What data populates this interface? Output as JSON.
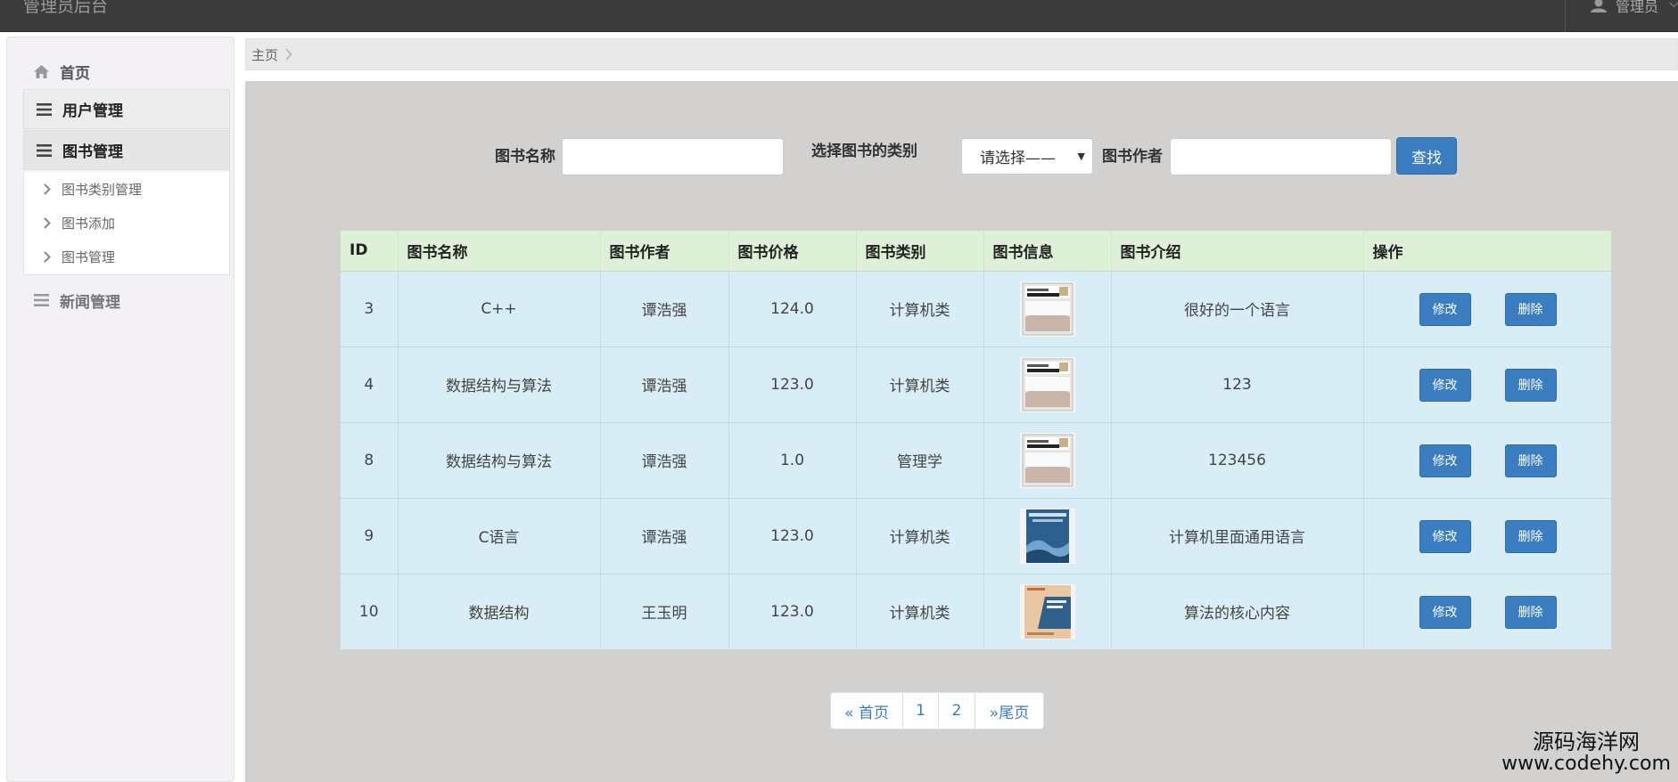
{
  "header": {
    "app_title": "管理员后台",
    "user_name": "管理员",
    "user_icon": "user-icon",
    "caret_icon": "chevron-down-icon"
  },
  "sidebar": {
    "home": {
      "label": "首页",
      "icon": "home-icon"
    },
    "groups": [
      {
        "label": "用户管理",
        "icon": "menu-bars-icon"
      },
      {
        "label": "图书管理",
        "icon": "menu-bars-icon",
        "expanded": true,
        "items": [
          {
            "label": "图书类别管理",
            "icon": "chevron-right-icon"
          },
          {
            "label": "图书添加",
            "icon": "chevron-right-icon"
          },
          {
            "label": "图书管理",
            "icon": "chevron-right-icon"
          }
        ]
      },
      {
        "label": "新闻管理",
        "icon": "menu-bars-icon"
      }
    ]
  },
  "breadcrumb": {
    "home": "主页"
  },
  "search": {
    "name_label": "图书名称",
    "name_value": "",
    "category_label": "选择图书的类别",
    "category_selected": "请选择——",
    "author_label": "图书作者",
    "author_value": "",
    "find_button": "查找"
  },
  "table": {
    "columns": [
      "ID",
      "图书名称",
      "图书作者",
      "图书价格",
      "图书类别",
      "图书信息",
      "图书介绍",
      "操作"
    ],
    "rows": [
      {
        "id": "3",
        "name": "C++",
        "author": "谭浩强",
        "price": "124.0",
        "category": "计算机类",
        "cover": "cpp-primer-cover",
        "intro": "很好的一个语言"
      },
      {
        "id": "4",
        "name": "数据结构与算法",
        "author": "谭浩强",
        "price": "123.0",
        "category": "计算机类",
        "cover": "cpp-primer-cover",
        "intro": "123"
      },
      {
        "id": "8",
        "name": "数据结构与算法",
        "author": "谭浩强",
        "price": "1.0",
        "category": "管理学",
        "cover": "cpp-primer-cover",
        "intro": "123456"
      },
      {
        "id": "9",
        "name": "C语言",
        "author": "谭浩强",
        "price": "123.0",
        "category": "计算机类",
        "cover": "c-language-cover",
        "intro": "计算机里面通用语言"
      },
      {
        "id": "10",
        "name": "数据结构",
        "author": "王玉明",
        "price": "123.0",
        "category": "计算机类",
        "cover": "data-structure-cover",
        "intro": "算法的核心内容"
      }
    ],
    "edit_label": "修改",
    "delete_label": "删除"
  },
  "pagination": {
    "first": "« 首页",
    "pages": [
      "1",
      "2"
    ],
    "last": "»尾页"
  },
  "watermark": {
    "cn": "源码海洋网",
    "url": "www.codehy.com"
  },
  "colors": {
    "primary": "#3a7dc0",
    "header_bg": "#3b3b3b",
    "table_head_bg": "#dff0d8",
    "table_row_bg": "#d9edf7",
    "content_bg": "#d3d1d0"
  }
}
